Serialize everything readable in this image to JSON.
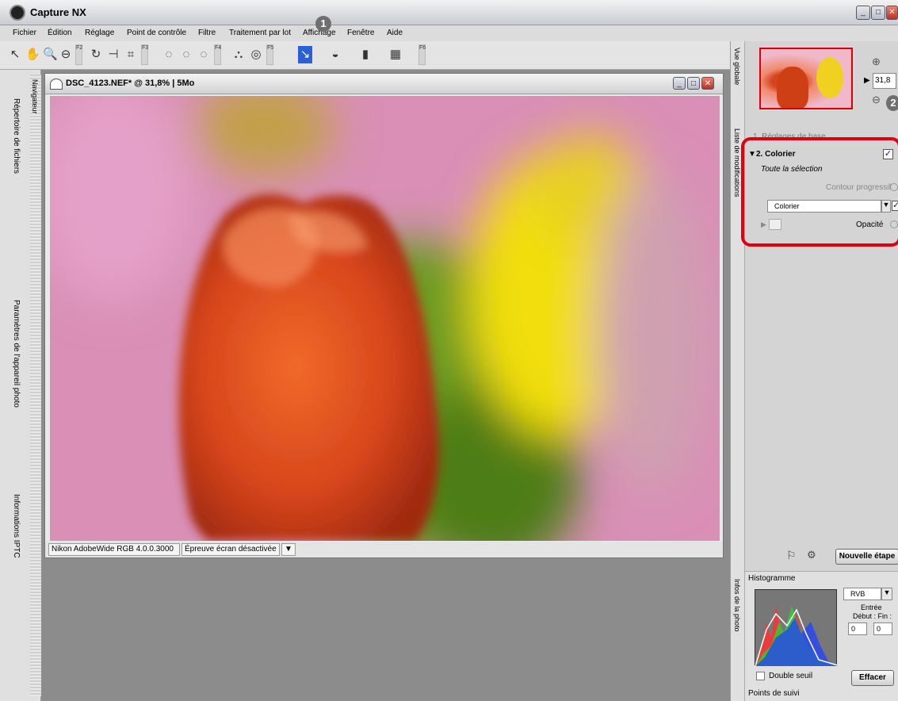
{
  "app": {
    "title": "Capture NX"
  },
  "menu": [
    "Fichier",
    "Édition",
    "Réglage",
    "Point de contrôle",
    "Filtre",
    "Traitement par lot",
    "Affichage",
    "Fenêtre",
    "Aide"
  ],
  "toolbar": {
    "fkeys": [
      "F2",
      "F3",
      "F4",
      "F5",
      "F6"
    ],
    "badge": "1"
  },
  "left_tabs": [
    "Navigateur",
    "Répertoire de fichiers",
    "Paramètres de l'appareil photo",
    "Informations IPTC"
  ],
  "image_window": {
    "title": "DSC_4123.NEF* @ 31,8% | 5Mo",
    "status": [
      "Nikon AdobeWide RGB 4.0.0.3000",
      "Épreuve écran désactivée"
    ]
  },
  "right_tabs": [
    "Vue globale",
    "Liste de modifications",
    "Infos de la photo"
  ],
  "overview": {
    "zoom": "31,8",
    "badge": "2"
  },
  "steps": {
    "step1": "1. Réglages de base",
    "step2": "2. Colorier",
    "selection": "Toute la sélection",
    "contour": "Contour progressif",
    "dropdown": "Colorier",
    "opacity": "Opacité",
    "new_step": "Nouvelle étape"
  },
  "histogram": {
    "title": "Histogramme",
    "channel": "RVB",
    "input": "Entrée",
    "range": "Début : Fin :",
    "start": "0",
    "end": "0",
    "double": "Double seuil",
    "clear": "Effacer",
    "tracking": "Points de suivi"
  }
}
